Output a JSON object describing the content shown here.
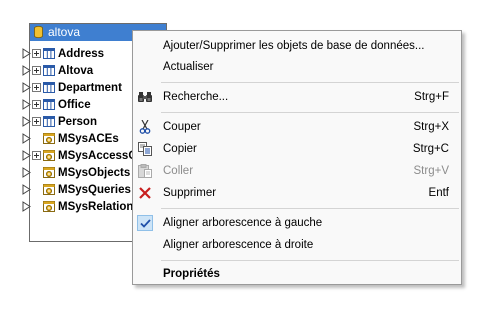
{
  "db_panel": {
    "title": "altova",
    "rows": [
      {
        "label": "Address",
        "expandable": true
      },
      {
        "label": "Altova",
        "expandable": true
      },
      {
        "label": "Department",
        "expandable": true
      },
      {
        "label": "Office",
        "expandable": true
      },
      {
        "label": "Person",
        "expandable": true
      },
      {
        "label": "MSysACEs",
        "expandable": false
      },
      {
        "label": "MSysAccessO",
        "expandable": true
      },
      {
        "label": "MSysObjects",
        "expandable": false
      },
      {
        "label": "MSysQueries",
        "expandable": false
      },
      {
        "label": "MSysRelation",
        "expandable": false
      }
    ]
  },
  "menu": {
    "add_remove": "Ajouter/Supprimer les objets de base de données...",
    "refresh": "Actualiser",
    "find": {
      "label": "Recherche...",
      "shortcut": "Strg+F"
    },
    "cut": {
      "label": "Couper",
      "shortcut": "Strg+X"
    },
    "copy": {
      "label": "Copier",
      "shortcut": "Strg+C"
    },
    "paste": {
      "label": "Coller",
      "shortcut": "Strg+V"
    },
    "delete": {
      "label": "Supprimer",
      "shortcut": "Entf"
    },
    "align_left": "Aligner arborescence à gauche",
    "align_right": "Aligner arborescence à droite",
    "properties": "Propriétés"
  }
}
